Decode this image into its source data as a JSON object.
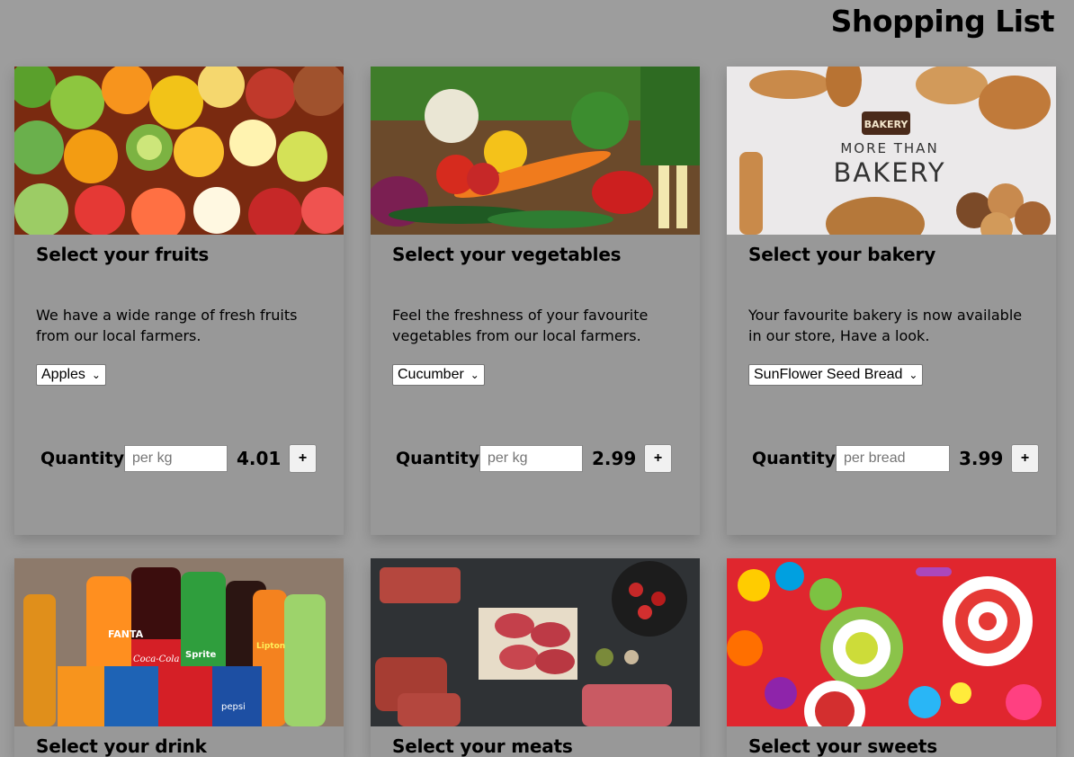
{
  "page": {
    "title": "Shopping List"
  },
  "cards": [
    {
      "title": "Select your fruits",
      "description": "We have a wide range of fresh fruits from our local farmers.",
      "selected": "Apples",
      "quantity_label": "Quantity:",
      "quantity_placeholder": "per kg",
      "price": "4.01",
      "add_label": "+"
    },
    {
      "title": "Select your vegetables",
      "description": "Feel the freshness of your favourite vegetables from our local farmers.",
      "selected": "Cucumber",
      "quantity_label": "Quantity:",
      "quantity_placeholder": "per kg",
      "price": "2.99",
      "add_label": "+"
    },
    {
      "title": "Select your bakery",
      "description": "Your favourite bakery is now available in our store, Have a look.",
      "selected": "SunFlower Seed Bread",
      "quantity_label": "Quantity:",
      "quantity_placeholder": "per bread",
      "price": "3.99",
      "add_label": "+",
      "image_text": {
        "badge": "BAKERY",
        "line1": "MORE THAN",
        "line2": "BAKERY"
      }
    },
    {
      "title": "Select your drink",
      "image_text": {
        "brand1": "FANTA",
        "brand2": "Coca-Cola",
        "brand3": "Sprite",
        "brand4": "pepsi",
        "brand5": "Lipton"
      }
    },
    {
      "title": "Select your meats"
    },
    {
      "title": "Select your sweets"
    }
  ]
}
